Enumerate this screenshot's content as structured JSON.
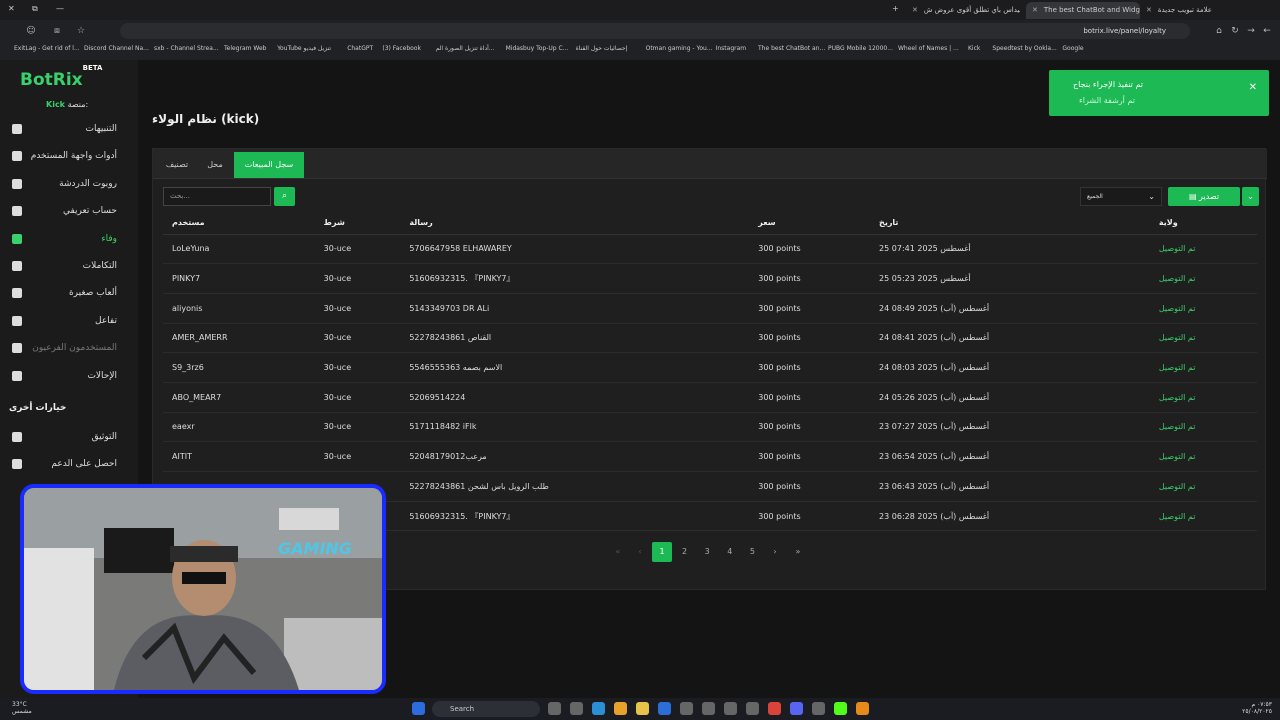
{
  "browser": {
    "tabs": [
      {
        "title": "علامة تبويب جديدة",
        "active": false
      },
      {
        "title": "The best ChatBot and Widgets",
        "active": true
      },
      {
        "title": "ميداس باي تطلق أقوى عروض ش...",
        "active": false
      }
    ],
    "url": "botrix.live/panel/loyalty",
    "bookmarks": [
      "ExitLag - Get rid of l...",
      "Discord Channel Na...",
      "sxb - Channel Strea...",
      "Telegram Web",
      "YouTube تنزيل فيديو",
      "ChatGPT",
      "(3) Facebook",
      "أداة تنزيل الصورة الم...",
      "Midasbuy Top-Up C...",
      "إحصائيات حول القناة",
      "Otman gaming - You...",
      "Instagram",
      "The best ChatBot an...",
      "PUBG Mobile 12000...",
      "Wheel of Names | ...",
      "Kick",
      "Speedtest by Ookla...",
      "Google"
    ]
  },
  "sidebar": {
    "logo": "BotRix",
    "logo_badge": "BETA",
    "platform_label": "منصة:",
    "platform_value": "Kick",
    "items": [
      {
        "label": "التنبيهات",
        "icon": "warning-icon"
      },
      {
        "label": "أدوات واجهة المستخدم",
        "icon": "widgets-icon"
      },
      {
        "label": "روبوت الدردشة",
        "icon": "bot-icon"
      },
      {
        "label": "حساب تعريفي",
        "icon": "profile-icon"
      },
      {
        "label": "وفاء",
        "icon": "trophy-icon"
      },
      {
        "label": "التكاملات",
        "icon": "integrations-icon"
      },
      {
        "label": "ألعاب صغيرة",
        "icon": "gamepad-icon"
      },
      {
        "label": "تفاعل",
        "icon": "music-icon"
      },
      {
        "label": "المستخدمون الفرعيون",
        "icon": "users-icon"
      },
      {
        "label": "الإحالات",
        "icon": "referrals-icon"
      }
    ],
    "section_title": "خيارات أخرى",
    "other_items": [
      {
        "label": "التوثيق",
        "icon": "docs-icon"
      },
      {
        "label": "احصل على الدعم",
        "icon": "help-icon"
      }
    ]
  },
  "page": {
    "title": "نظام الولاء (kick)",
    "tabs": [
      "تصنيف",
      "محل",
      "سجل المبيعات"
    ],
    "search_placeholder": "بحث...",
    "filter_value": "الجميع",
    "export_label": "تصدير",
    "columns": [
      "مستخدم",
      "شرط",
      "رسالة",
      "سعر",
      "تاريخ",
      "ولاية"
    ],
    "rows": [
      [
        "LoLeYuna",
        "30-uce",
        "5706647958 ELHAWAREY",
        "300 points",
        "25 أغسطس 2025 07:41",
        "تم التوصيل"
      ],
      [
        "PINKY7",
        "30-uce",
        "51606932315. 『PINKY7』",
        "300 points",
        "25 أغسطس 2025 05:23",
        "تم التوصيل"
      ],
      [
        "aliyonis",
        "30-uce",
        "5143349703 DR ALi",
        "300 points",
        "24 أغسطس (آب) 2025 08:49",
        "تم التوصيل"
      ],
      [
        "AMER_AMERR",
        "30-uce",
        "52278243861 القناص",
        "300 points",
        "24 أغسطس (آب) 2025 08:41",
        "تم التوصيل"
      ],
      [
        "S9_3rz6",
        "30-uce",
        "5546555363 الاسم بصمه",
        "300 points",
        "24 أغسطس (آب) 2025 08:03",
        "تم التوصيل"
      ],
      [
        "ABO_MEAR7",
        "30-uce",
        "52069514224",
        "300 points",
        "24 أغسطس (آب) 2025 05:26",
        "تم التوصيل"
      ],
      [
        "eaexr",
        "30-uce",
        "5171118482 iFlk",
        "300 points",
        "23 أغسطس (آب) 2025 07:27",
        "تم التوصيل"
      ],
      [
        "AITIT",
        "30-uce",
        "52048179012مرعب",
        "300 points",
        "23 أغسطس (آب) 2025 06:54",
        "تم التوصيل"
      ],
      [
        "",
        "",
        "52278243861 طلب الرويل باس لشحن",
        "300 points",
        "23 أغسطس (آب) 2025 06:43",
        "تم التوصيل"
      ],
      [
        "",
        "",
        "51606932315. 『PINKY7』",
        "300 points",
        "23 أغسطس (آب) 2025 06:28",
        "تم التوصيل"
      ]
    ],
    "pages": [
      "1",
      "2",
      "3",
      "4",
      "5"
    ]
  },
  "toast": {
    "title": "تم تنفيذ الإجراء بنجاح",
    "message": "تم أرشفة الشراء"
  },
  "webcam": {
    "overlay_text": "GAMING"
  },
  "taskbar": {
    "weather": "33°C",
    "weather_sub": "مشمس",
    "search": "Search",
    "time": "٠٧:٥٣ م",
    "date": "٢٥/٠٨/٢٠٢٥"
  },
  "colors": {
    "accent": "#1db954",
    "bg": "#141414",
    "webcam_border": "#1a2bff"
  }
}
